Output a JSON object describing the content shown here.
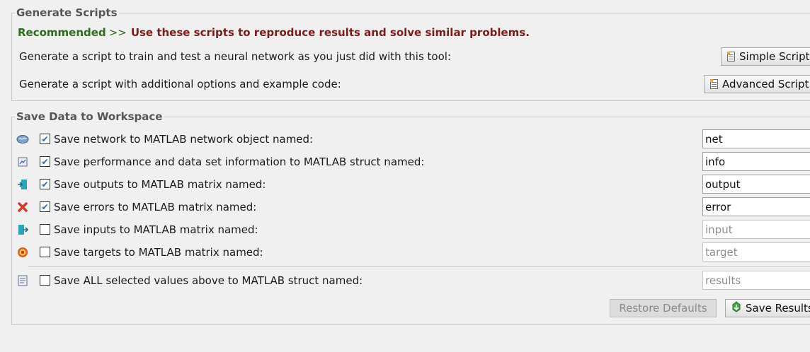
{
  "generate_scripts": {
    "title": "Generate Scripts",
    "recommended_label": "Recommended",
    "recommended_arrows": ">>",
    "recommended_message": "Use these scripts to reproduce results and solve similar problems.",
    "simple_desc": "Generate a script to train and test a neural network as you just did with this tool:",
    "simple_button": "Simple Script",
    "advanced_desc": "Generate a script with additional options and example code:",
    "advanced_button": "Advanced Script"
  },
  "save_data": {
    "title": "Save Data to Workspace",
    "rows": [
      {
        "label": "Save network to MATLAB network object named:",
        "checked": true,
        "value": "net",
        "icon": "network-icon"
      },
      {
        "label": "Save performance and data set information to MATLAB struct named:",
        "checked": true,
        "value": "info",
        "icon": "performance-icon"
      },
      {
        "label": "Save outputs to MATLAB matrix named:",
        "checked": true,
        "value": "output",
        "icon": "outputs-icon"
      },
      {
        "label": "Save errors to MATLAB matrix named:",
        "checked": true,
        "value": "error",
        "icon": "errors-icon"
      },
      {
        "label": "Save inputs to MATLAB matrix named:",
        "checked": false,
        "value": "input",
        "icon": "inputs-icon"
      },
      {
        "label": "Save targets to MATLAB matrix named:",
        "checked": false,
        "value": "target",
        "icon": "targets-icon"
      }
    ],
    "all_row": {
      "label": "Save ALL selected values above to MATLAB struct named:",
      "checked": false,
      "value": "results",
      "icon": "struct-icon"
    },
    "restore_button": "Restore Defaults",
    "save_button": "Save Results"
  },
  "colors": {
    "recommended": "#2e6b1e",
    "message": "#7a1d1d",
    "check": "#2b5fa6"
  }
}
